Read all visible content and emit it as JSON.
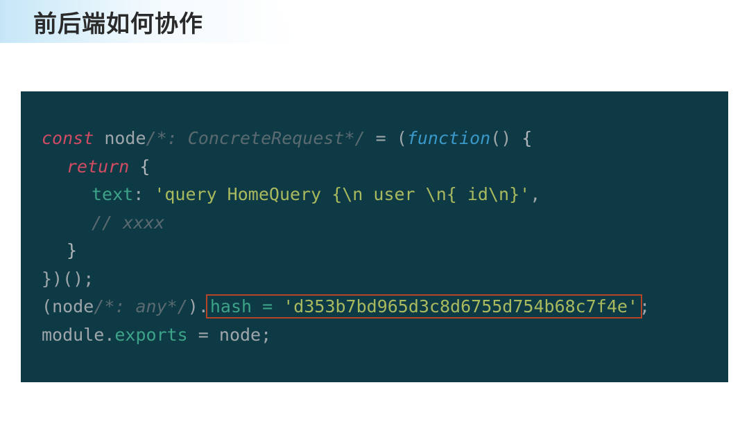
{
  "title": "前后端如何协作",
  "code": {
    "l1": {
      "kw_const": "const",
      "name": " node",
      "comment": "/*: ConcreteRequest*/",
      "eq": " = ",
      "paren_open": "(",
      "func": "function",
      "paren_args": "() ",
      "brace": "{"
    },
    "l2": {
      "kw_return": "return",
      "brace": " {"
    },
    "l3": {
      "prop": "text",
      "colon": ": ",
      "str": "'query HomeQuery {\\n user \\n{ id\\n}'",
      "comma": ","
    },
    "l4": {
      "comment": "// xxxx"
    },
    "l5": {
      "brace": "}"
    },
    "l6": {
      "close": "})();"
    },
    "l7": {
      "paren": "(",
      "name": "node",
      "comment": "/*: any*/",
      "paren_close": ")",
      "dot": ".",
      "method": "hash = ",
      "str": "'d353b7bd965d3c8d6755d754b68c7f4e'",
      "semi": ";"
    },
    "l8": {
      "mod": "module",
      "dot": ".",
      "exp": "exports",
      "eq": " = ",
      "node": "node",
      "semi": ";"
    }
  }
}
